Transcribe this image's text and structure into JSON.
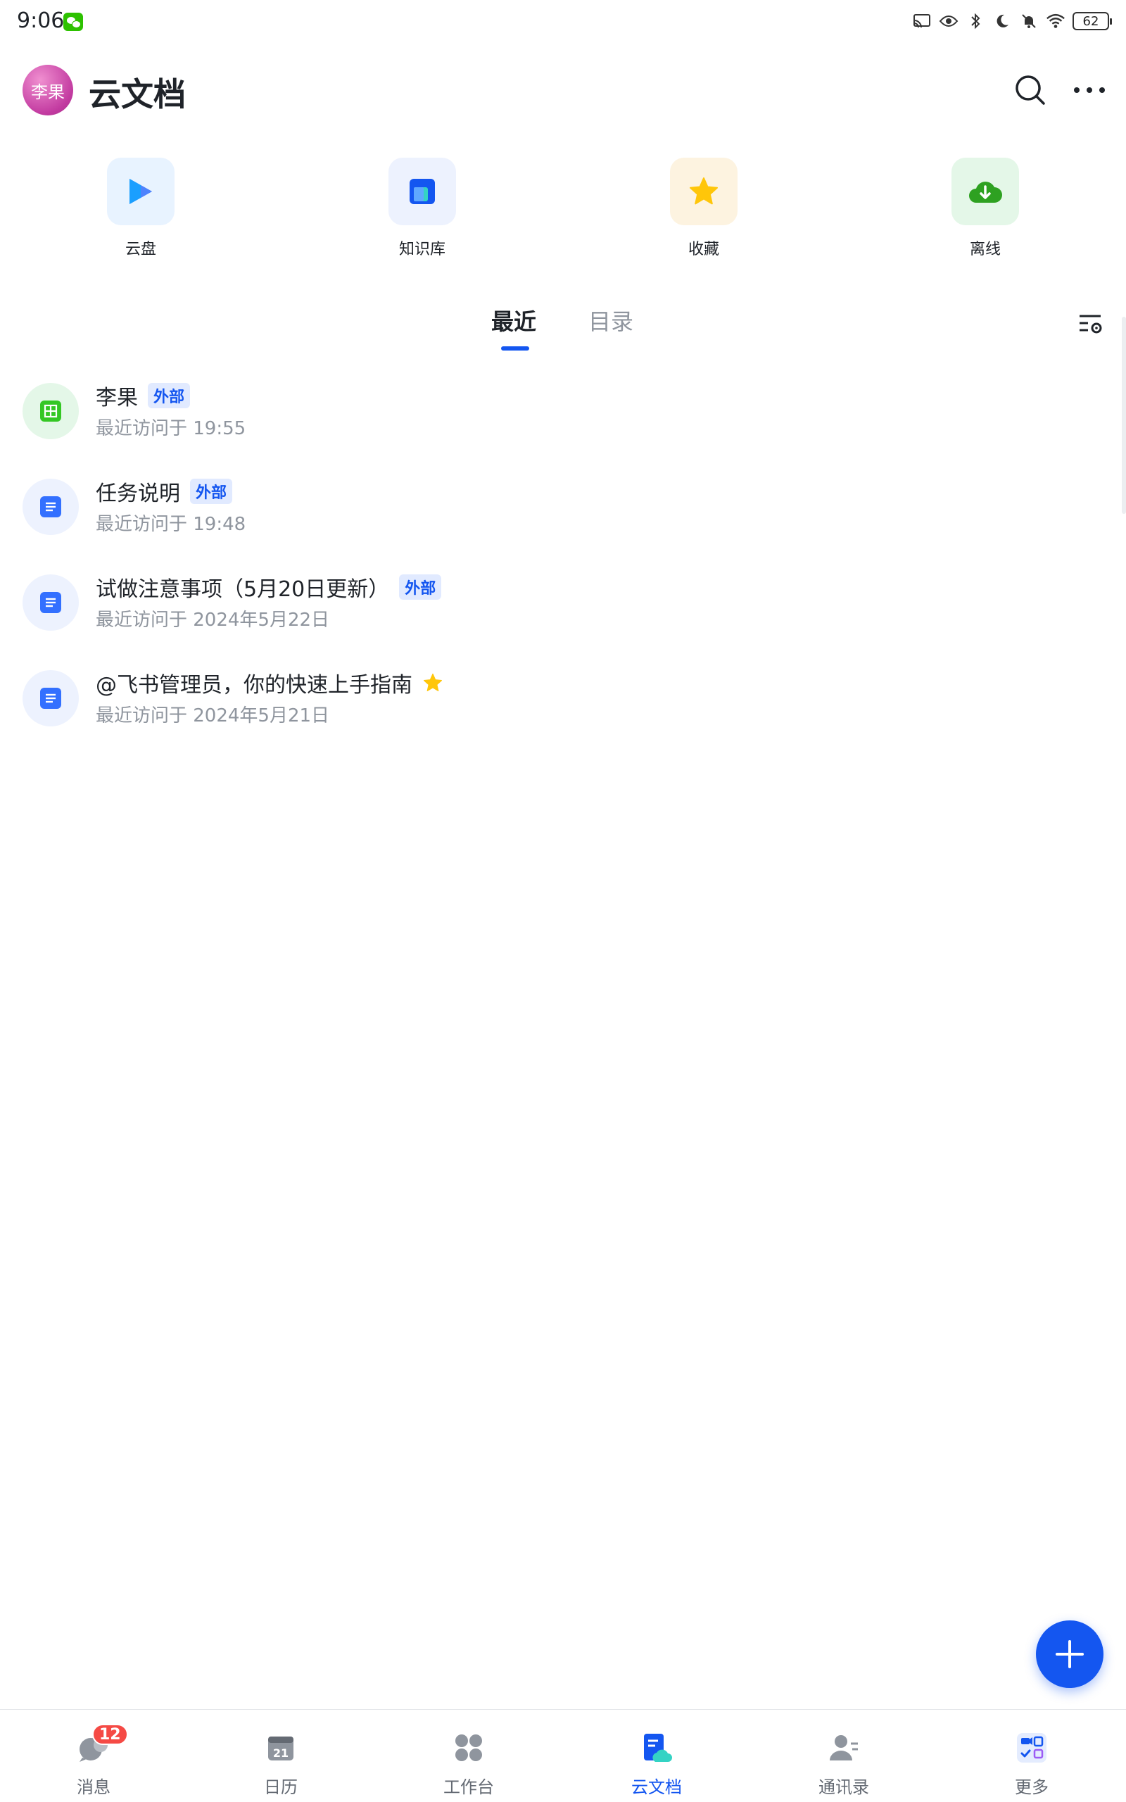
{
  "status_bar": {
    "time": "9:06",
    "battery": "62",
    "icons": [
      "wechat-icon",
      "cast-icon",
      "eye-icon",
      "bluetooth-icon",
      "moon-icon",
      "bell-off-icon",
      "wifi-icon",
      "battery-icon"
    ]
  },
  "header": {
    "avatar_text": "李果",
    "title": "云文档",
    "search_icon": "search-icon",
    "more_icon": "more-icon"
  },
  "quick_access": [
    {
      "label": "云盘",
      "icon": "cloud-drive-icon",
      "bg": "#e8f3ff"
    },
    {
      "label": "知识库",
      "icon": "wiki-icon",
      "bg": "#edf2fe"
    },
    {
      "label": "收藏",
      "icon": "star-icon",
      "bg": "#fdf3e0"
    },
    {
      "label": "离线",
      "icon": "offline-download-icon",
      "bg": "#e4f7e8"
    }
  ],
  "tabs": {
    "recent": "最近",
    "directory": "目录"
  },
  "documents": [
    {
      "title": "李果",
      "badge": "外部",
      "meta": "最近访问于 19:55",
      "type": "sheet",
      "starred": false
    },
    {
      "title": "任务说明",
      "badge": "外部",
      "meta": "最近访问于 19:48",
      "type": "doc",
      "starred": false
    },
    {
      "title": "试做注意事项（5月20日更新）",
      "badge": "外部",
      "meta": "最近访问于 2024年5月22日",
      "type": "doc",
      "starred": false
    },
    {
      "title": "@飞书管理员，你的快速上手指南",
      "badge": "",
      "meta": "最近访问于 2024年5月21日",
      "type": "doc",
      "starred": true
    }
  ],
  "bottom_nav": [
    {
      "label": "消息",
      "badge": "12"
    },
    {
      "label": "日历",
      "calendar_day": "21"
    },
    {
      "label": "工作台"
    },
    {
      "label": "云文档",
      "active": true
    },
    {
      "label": "通讯录"
    },
    {
      "label": "更多"
    }
  ],
  "colors": {
    "accent": "#1456f0",
    "badge_red": "#f54a45",
    "star": "#ffc60a"
  }
}
